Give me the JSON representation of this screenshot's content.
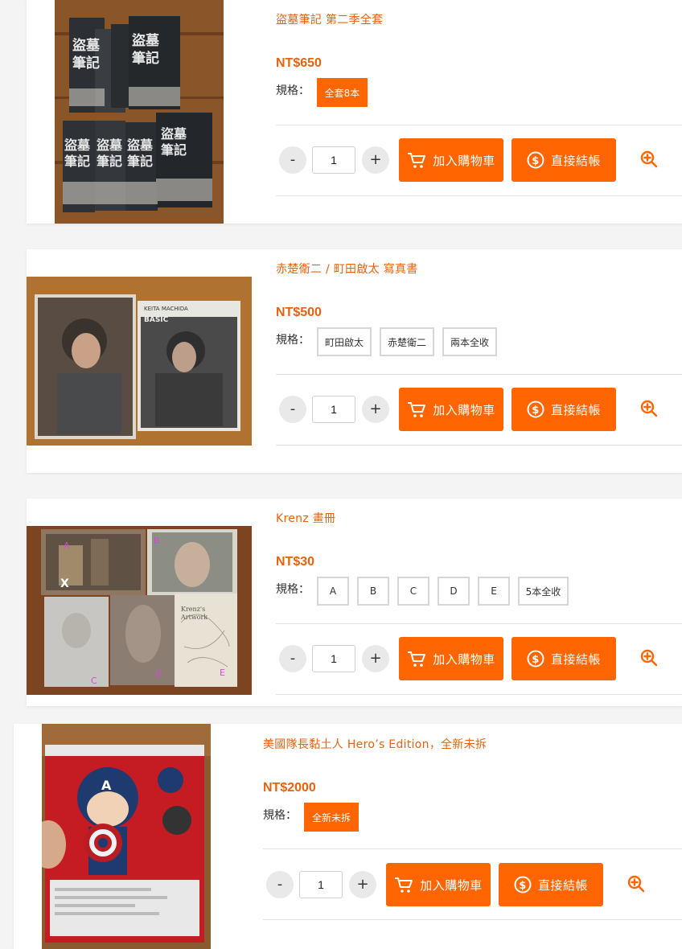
{
  "products": [
    {
      "title": "盜墓筆記 第二季全套",
      "price": "NT$650",
      "spec_label": "規格：",
      "options": [
        {
          "label": "全套8本",
          "selected": true
        }
      ],
      "quantity": "1",
      "minus": "-",
      "plus": "+",
      "add_cart_label": "加入購物車",
      "checkout_label": "直接結帳"
    },
    {
      "title": "赤楚衛二 / 町田啟太 寫真書",
      "price": "NT$500",
      "spec_label": "規格：",
      "options": [
        {
          "label": "町田啟太",
          "selected": false
        },
        {
          "label": "赤楚衛二",
          "selected": false
        },
        {
          "label": "兩本全收",
          "selected": false
        }
      ],
      "quantity": "1",
      "minus": "-",
      "plus": "+",
      "add_cart_label": "加入購物車",
      "checkout_label": "直接結帳"
    },
    {
      "title": "Krenz 畫冊",
      "price": "NT$30",
      "spec_label": "規格：",
      "options": [
        {
          "label": "A",
          "selected": false
        },
        {
          "label": "B",
          "selected": false
        },
        {
          "label": "C",
          "selected": false
        },
        {
          "label": "D",
          "selected": false
        },
        {
          "label": "E",
          "selected": false
        },
        {
          "label": "5本全收",
          "selected": false
        }
      ],
      "quantity": "1",
      "minus": "-",
      "plus": "+",
      "add_cart_label": "加入購物車",
      "checkout_label": "直接結帳"
    },
    {
      "title": "美國隊長黏土人 Hero’s Edition，全新未拆",
      "price": "NT$2000",
      "spec_label": "規格：",
      "options": [
        {
          "label": "全新未拆",
          "selected": true
        }
      ],
      "quantity": "1",
      "minus": "-",
      "plus": "+",
      "add_cart_label": "加入購物車",
      "checkout_label": "直接結帳"
    }
  ],
  "colors": {
    "accent": "#ff6500",
    "title": "#e8620c"
  },
  "icons": {
    "cart": "cart-icon",
    "dollar": "dollar-coin-icon",
    "zoom": "zoom-in-icon"
  }
}
